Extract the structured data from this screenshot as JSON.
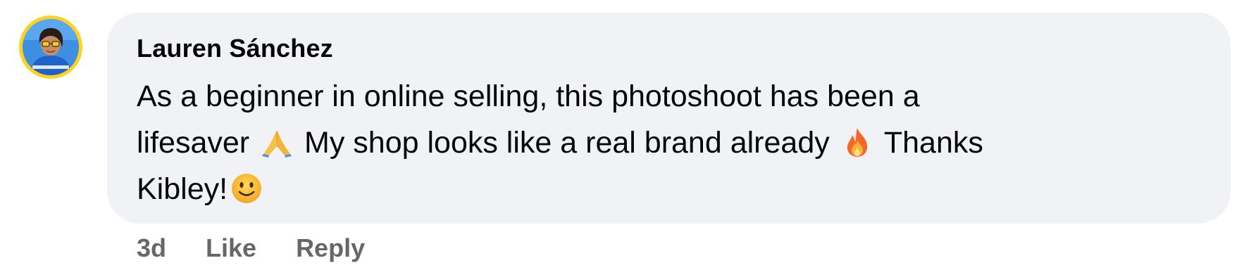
{
  "comment": {
    "author": "Lauren Sánchez",
    "avatar_icon": "profile-photo-avatar",
    "avatar_frame_color": "#ffd21f",
    "body_lines": [
      {
        "text": "As a beginner in online selling, this photoshoot has been a"
      },
      {
        "text_before": "lifesaver",
        "emoji_1": "folded-hands-icon",
        "text_middle": "My shop looks like a real brand already",
        "emoji_2": "fire-icon",
        "text_after": "Thanks"
      },
      {
        "text_before": "Kibley!",
        "emoji_3": "smiling-face-icon"
      }
    ],
    "timestamp": "3d",
    "like_label": "Like",
    "reply_label": "Reply"
  },
  "colors": {
    "bubble_background": "#f0f2f5",
    "author_text": "#050505",
    "action_text": "#65676b"
  }
}
